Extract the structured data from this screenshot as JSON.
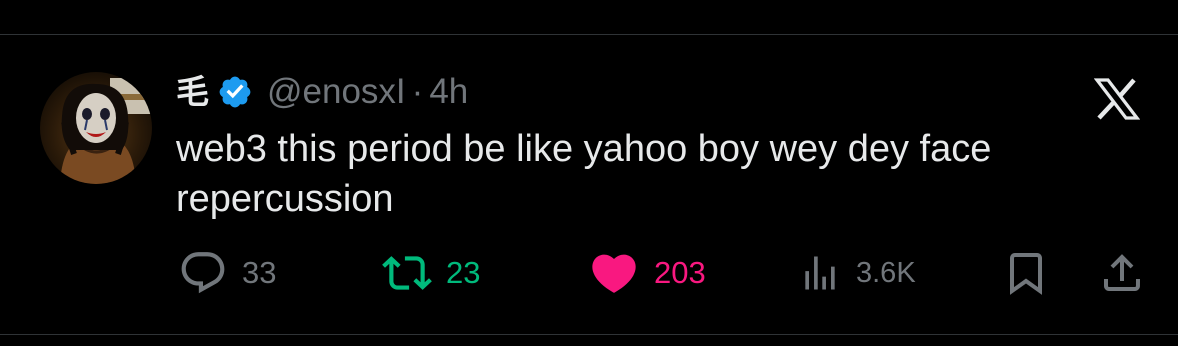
{
  "tweet": {
    "display_name": "毛",
    "verified": true,
    "handle": "@enosxI",
    "separator": "·",
    "time": "4h",
    "text": "web3 this period be like yahoo boy wey dey face repercussion"
  },
  "actions": {
    "reply_count": "33",
    "retweet_count": "23",
    "like_count": "203",
    "views_count": "3.6K"
  },
  "icons": {
    "verified": "verified-badge-icon",
    "platform": "x-logo-icon",
    "reply": "reply-icon",
    "retweet": "retweet-icon",
    "like": "heart-icon",
    "views": "views-icon",
    "bookmark": "bookmark-icon",
    "share": "share-icon"
  },
  "colors": {
    "background": "#000000",
    "text_primary": "#e7e9ea",
    "text_secondary": "#71767b",
    "verified_blue": "#1d9bf0",
    "retweet_green": "#00ba7c",
    "like_pink": "#f91880",
    "divider": "#2f3336"
  }
}
